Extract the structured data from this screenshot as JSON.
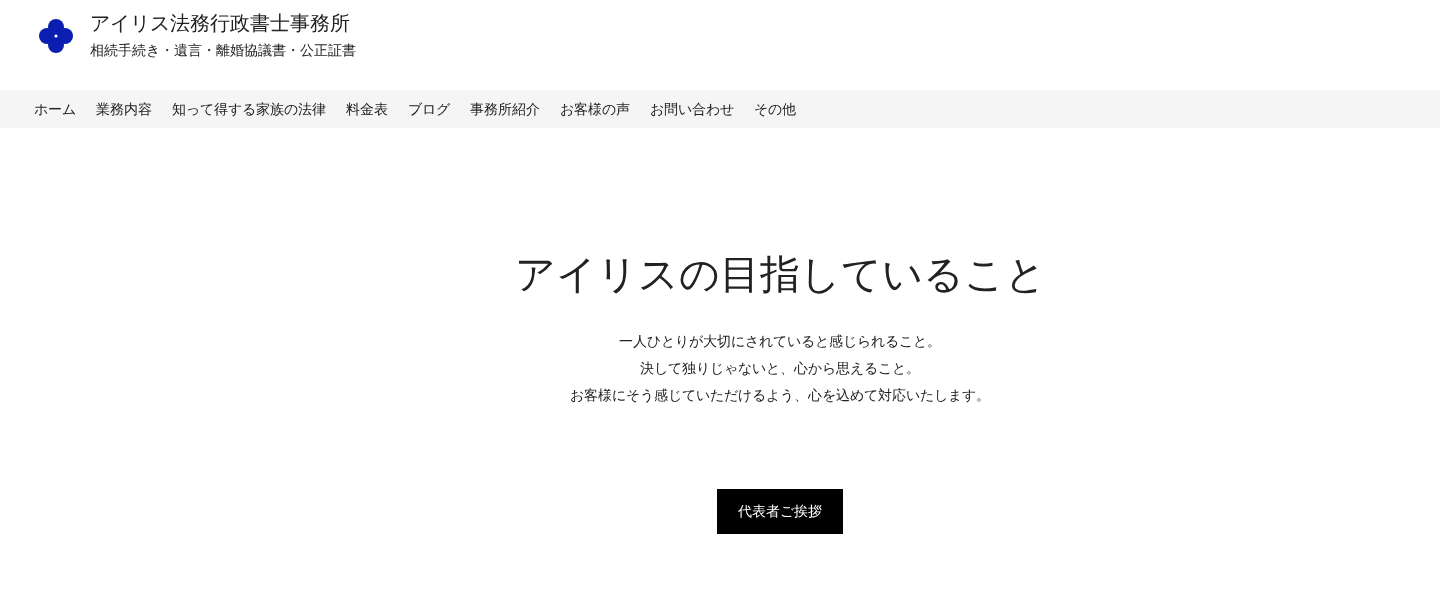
{
  "site": {
    "title": "アイリス法務行政書士事務所",
    "tagline": "相続手続き・遺言・離婚協議書・公正証書"
  },
  "nav": [
    {
      "label": "ホーム"
    },
    {
      "label": "業務内容"
    },
    {
      "label": "知って得する家族の法律"
    },
    {
      "label": "料金表"
    },
    {
      "label": "ブログ"
    },
    {
      "label": "事務所紹介"
    },
    {
      "label": "お客様の声"
    },
    {
      "label": "お問い合わせ"
    },
    {
      "label": "その他"
    }
  ],
  "hero": {
    "heading": "アイリスの目指していること",
    "lines": [
      "一人ひとりが大切にされていると感じられること。",
      "決して独りじゃないと、心から思えること。",
      "お客様にそう感じていただけるよう、心を込めて対応いたします。"
    ],
    "button": "代表者ご挨拶"
  }
}
